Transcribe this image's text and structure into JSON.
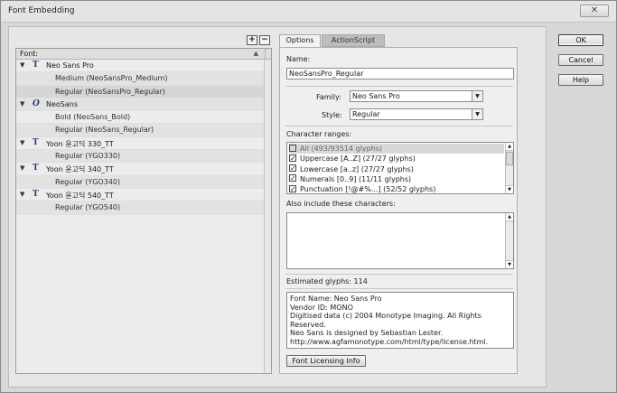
{
  "window": {
    "title": "Font Embedding"
  },
  "font_panel": {
    "header": "Font:",
    "add_label": "+",
    "remove_label": "−",
    "items": [
      {
        "type": "family",
        "label": "Neo Sans Pro",
        "icon": "T"
      },
      {
        "type": "style",
        "label": "Medium (NeoSansPro_Medium)"
      },
      {
        "type": "style",
        "label": "Regular (NeoSansPro_Regular)"
      },
      {
        "type": "family",
        "label": "NeoSans",
        "icon": "O"
      },
      {
        "type": "style",
        "label": "Bold (NeoSans_Bold)"
      },
      {
        "type": "style",
        "label": "Regular (NeoSans_Regular)"
      },
      {
        "type": "family",
        "label": "Yoon 윤고딕 330_TT",
        "icon": "T"
      },
      {
        "type": "style",
        "label": "Regular (YGO330)"
      },
      {
        "type": "family",
        "label": "Yoon 윤고딕 340_TT",
        "icon": "T"
      },
      {
        "type": "style",
        "label": "Regular (YGO340)"
      },
      {
        "type": "family",
        "label": "Yoon 윤고딕 540_TT",
        "icon": "T"
      },
      {
        "type": "style",
        "label": "Regular (YGO540)"
      }
    ]
  },
  "tabs": [
    {
      "label": "Options",
      "active": true
    },
    {
      "label": "ActionScript",
      "active": false
    }
  ],
  "options": {
    "name_label": "Name:",
    "name_value": "NeoSansPro_Regular",
    "family_label": "Family:",
    "family_value": "Neo Sans Pro",
    "style_label": "Style:",
    "style_value": "Regular",
    "ranges_label": "Character ranges:",
    "ranges": [
      {
        "label": "All  (493/93514 glyphs)",
        "checked": false
      },
      {
        "label": "Uppercase [A..Z]  (27/27 glyphs)",
        "checked": true
      },
      {
        "label": "Lowercase [a..z]  (27/27 glyphs)",
        "checked": true
      },
      {
        "label": "Numerals [0..9]  (11/11 glyphs)",
        "checked": true
      },
      {
        "label": "Punctuation [!@#%...]  (52/52 glyphs)",
        "checked": true
      }
    ],
    "include_label": "Also include these characters:",
    "include_value": "",
    "estimated_label": "Estimated glyphs: 114",
    "font_info": [
      "Font Name: Neo Sans Pro",
      "Vendor ID: MONO",
      "Digitised data (c) 2004 Monotype Imaging. All Rights Reserved.",
      "Neo Sans is designed by Sebastian Lester.",
      "http://www.agfamonotype.com/html/type/license.html."
    ],
    "licensing_button": "Font Licensing Info"
  },
  "buttons": {
    "ok": "OK",
    "cancel": "Cancel",
    "help": "Help"
  },
  "icons": {
    "close": "close-icon",
    "family_truetype": "truetype-font-icon",
    "family_opentype": "opentype-font-icon",
    "expand": "triangle-down-icon"
  },
  "colors": {
    "window_bg": "#d8d8d8",
    "panel_bg": "#e6e6e6",
    "font_icon": "#23407c"
  }
}
